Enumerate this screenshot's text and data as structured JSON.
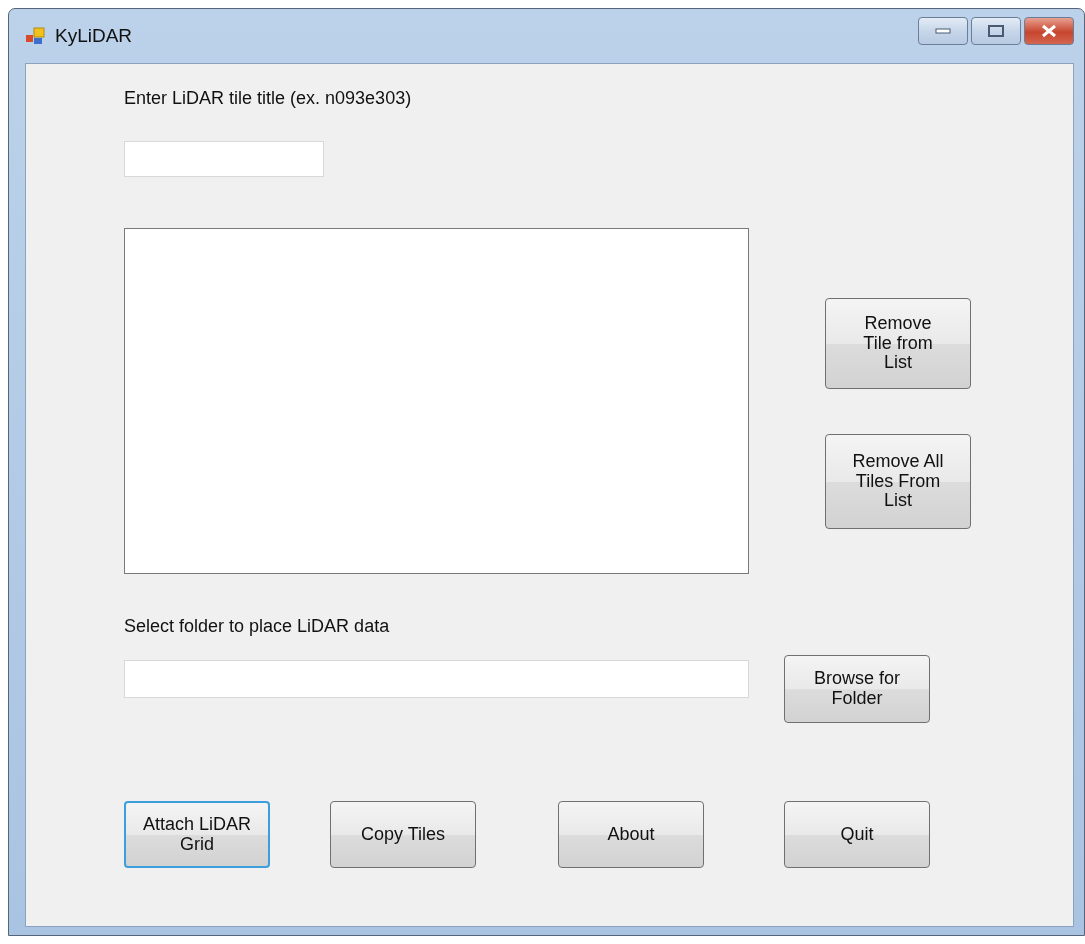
{
  "window": {
    "title": "KyLiDAR"
  },
  "tile_entry": {
    "label": "Enter LiDAR tile title (ex. n093e303)"
  },
  "side_buttons": [
    {
      "label": "Remove Tile from List",
      "focused": false
    },
    {
      "label": "Remove All Tiles From List",
      "focused": false
    }
  ],
  "folder": {
    "label": "Select folder to place LiDAR data",
    "browse_button": {
      "label": "Browse for Folder",
      "focused": false
    }
  },
  "bottom_buttons": [
    {
      "label": "Attach LiDAR Grid",
      "focused": true
    },
    {
      "label": "Copy Tiles",
      "focused": false
    },
    {
      "label": "About",
      "focused": false
    },
    {
      "label": "Quit",
      "focused": false
    }
  ]
}
